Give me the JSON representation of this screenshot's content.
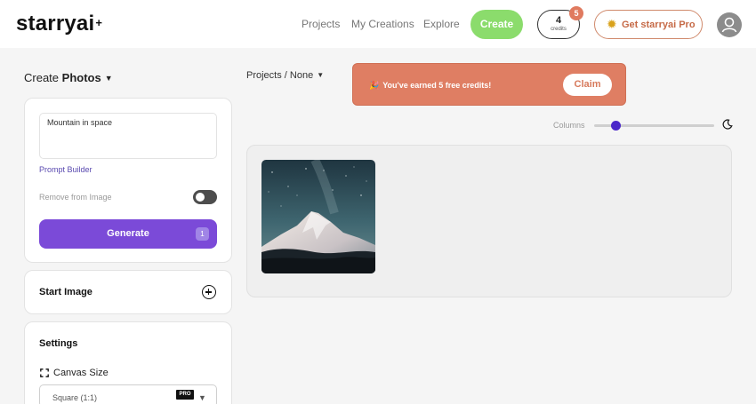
{
  "header": {
    "logo": "starryai",
    "logo_mark": "+",
    "nav": [
      "Projects",
      "My Creations",
      "Explore"
    ],
    "create_label": "Create",
    "credits": {
      "count": "4",
      "label": "credits",
      "badge": "5"
    },
    "pro_label": "Get starryai Pro",
    "pro_icon": "sun-icon",
    "avatar_icon": "user-icon"
  },
  "left": {
    "create_prefix": "Create",
    "create_type": "Photos",
    "prompt_value": "Mountain in space",
    "prompt_builder": "Prompt Builder",
    "remove_label": "Remove from Image",
    "remove_toggle_on": false,
    "generate_label": "Generate",
    "generate_badge": "1",
    "start_image_label": "Start Image",
    "settings_label": "Settings",
    "canvas_size_label": "Canvas Size",
    "canvas_size_value": "Square (1:1)",
    "pro_tag": "PRO"
  },
  "right": {
    "breadcrumb": "Projects / None",
    "notice_text": "You've earned 5 free credits!",
    "notice_emoji": "🎉",
    "claim_label": "Claim",
    "columns_label": "Columns",
    "columns_slider_value": 0.18,
    "theme_icon": "moon-icon",
    "image_subject": "snowy mountain under starry night sky"
  },
  "colors": {
    "accent_purple": "#7b4ad8",
    "create_green": "#8bdc6c",
    "notice_orange": "#df7e63",
    "slider_knob": "#4a27c9"
  }
}
